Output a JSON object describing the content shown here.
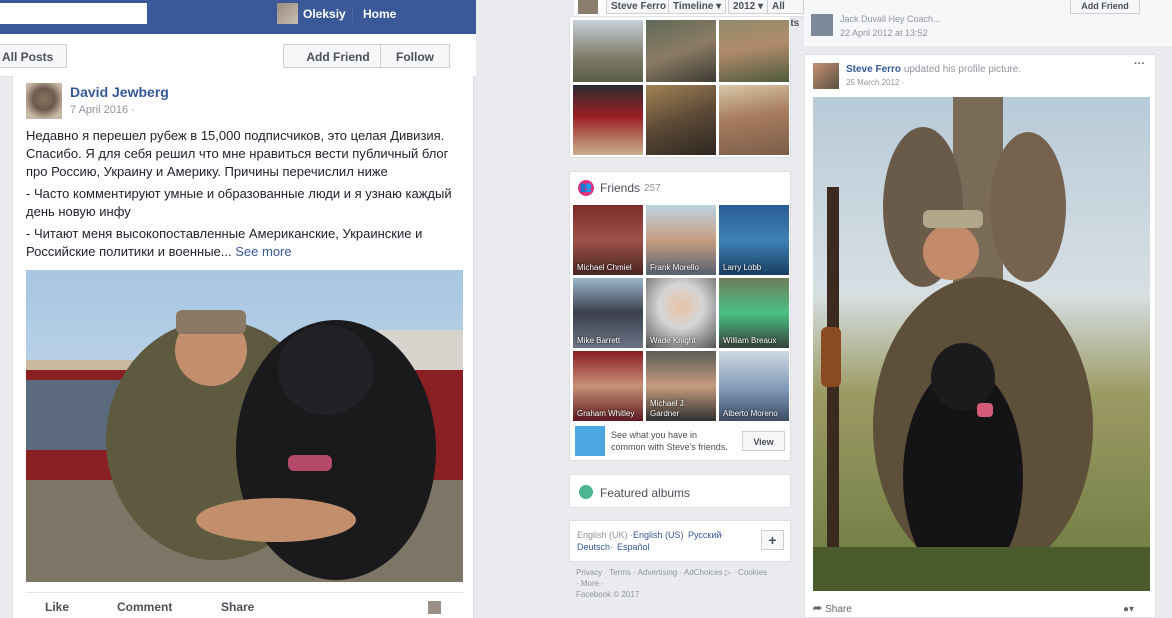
{
  "left_panel": {
    "topbar": {
      "user_name": "Oleksiy",
      "home_label": "Home"
    },
    "post_header": {
      "all_posts_label": "All Posts",
      "add_friend_label": "Add Friend",
      "follow_label": "Follow"
    },
    "post": {
      "author": "David Jewberg",
      "date": "7 April 2016 ·",
      "paragraphs": [
        "Недавно я перешел рубеж в 15,000 подписчиков, это целая Дивизия. Спасибо. Я для себя решил что мне нравиться вести публичный блог про Россию, Украину и Америку. Причины перечислил ниже",
        "- Часто комментируют умные и образованные люди и я узнаю каждый день новую инфу",
        "- Читают меня высокопоставленные Американские, Украинские и Российские политики и военные..."
      ],
      "see_more": "See more",
      "actions": {
        "like": "Like",
        "comment": "Comment",
        "share": "Share"
      }
    }
  },
  "middle_panel": {
    "profile_bar": {
      "name": "Steve Ferro",
      "timeline": "Timeline",
      "year": "2012",
      "all_posts": "All Posts"
    },
    "friends": {
      "title": "Friends",
      "count": "257",
      "people": [
        "Michael Chmiel",
        "Frank Morello",
        "Larry Lobb",
        "Mike Barrett",
        "Wade Knight",
        "William Breaux",
        "Graham Whitley",
        "Michael J. Gardner",
        "Alberto Moreno"
      ],
      "common_text": "See what you have in common with Steve's friends.",
      "view_label": "View"
    },
    "featured_albums": "Featured albums",
    "languages": {
      "current": "English (UK) ·",
      "options": [
        "English (US)",
        "Русский",
        "Deutsch",
        "Español"
      ]
    },
    "footer": {
      "links": [
        "Privacy",
        "Terms",
        "Advertising",
        "AdChoices",
        "Cookies",
        "More"
      ],
      "copyright": "Facebook © 2017"
    }
  },
  "right_panel": {
    "top_post": {
      "author_truncated": "Jack Duvall Hey Coach...",
      "date": "22 April 2012 at 13:52",
      "add_friend_label": "Add Friend"
    },
    "post": {
      "author": "Steve Ferro",
      "action_text": "updated his profile picture.",
      "date": "25 March 2012 ·",
      "share_label": "Share"
    }
  },
  "colors": {
    "brand_blue": "#3b5998",
    "link_blue": "#365899",
    "background": "#e9ebee",
    "friends_icon": "#e4317b",
    "albums_icon": "#4cb490"
  }
}
